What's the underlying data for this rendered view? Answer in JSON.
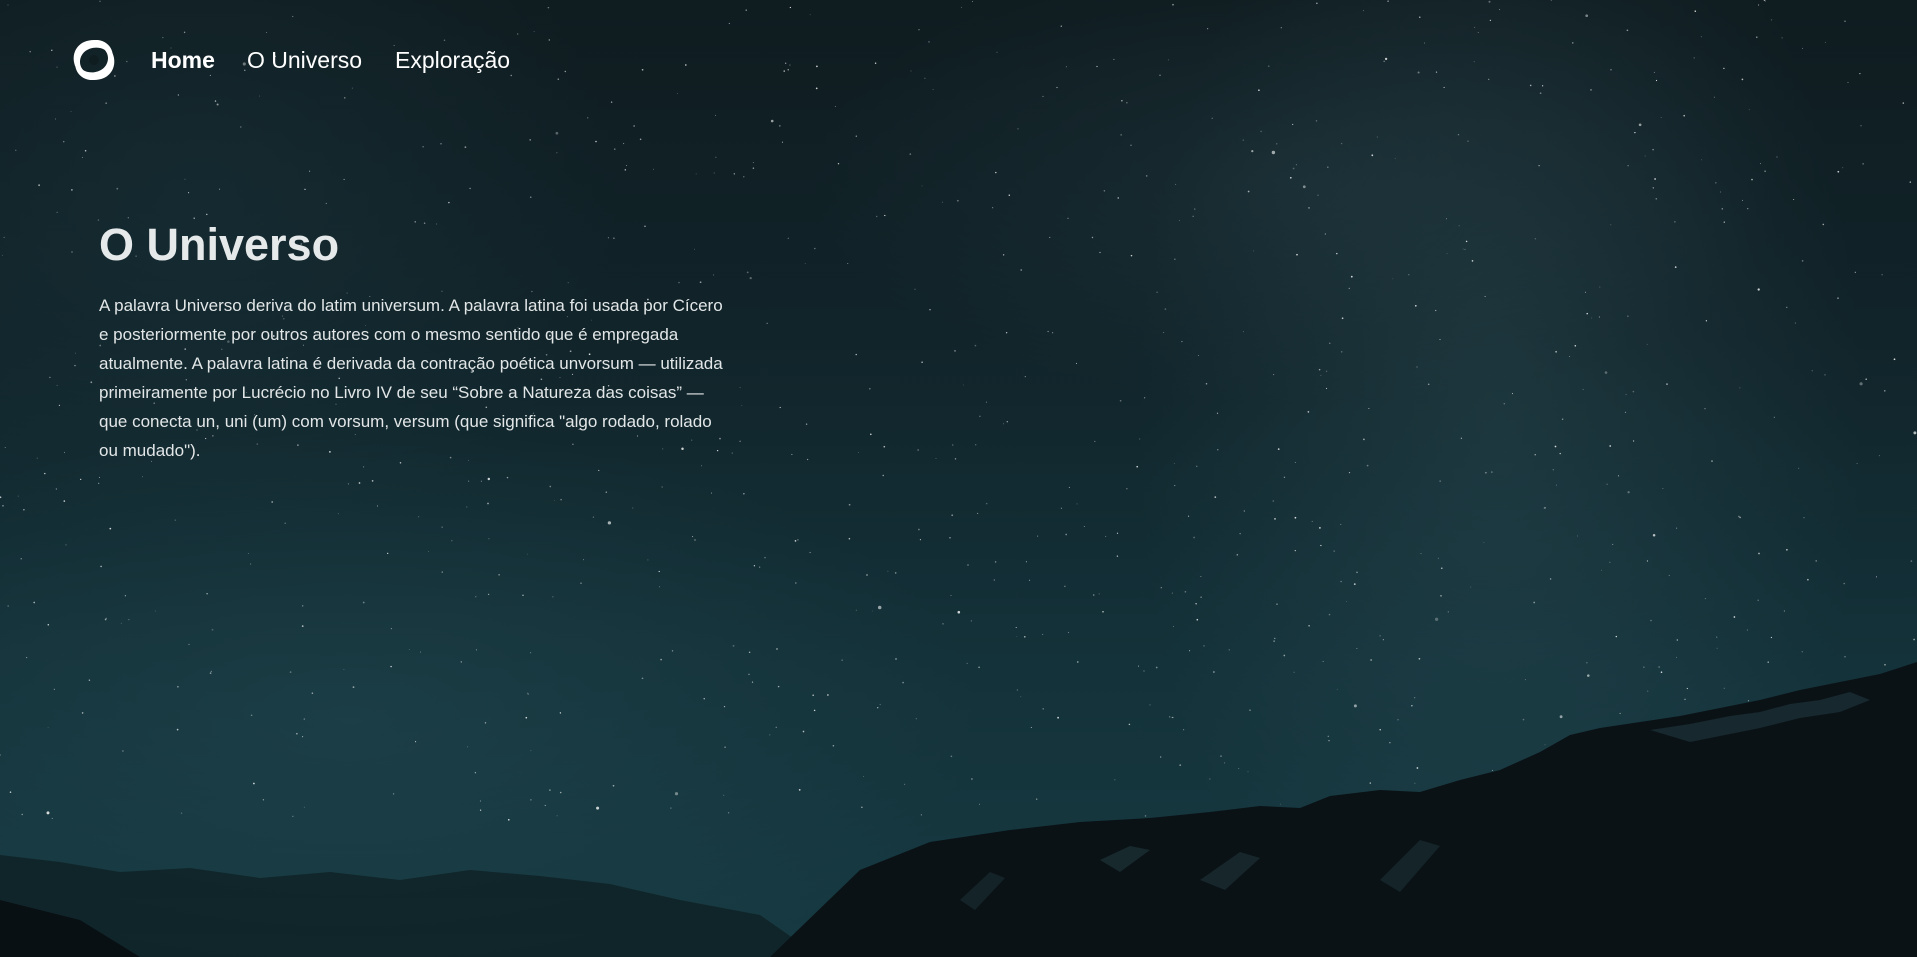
{
  "nav": {
    "logo_icon": "swirl-logo-icon",
    "items": [
      {
        "label": "Home",
        "active": true
      },
      {
        "label": "O Universo",
        "active": false
      },
      {
        "label": "Exploração",
        "active": false
      }
    ]
  },
  "hero": {
    "title": "O Universo",
    "paragraph": "A palavra Universo deriva do latim universum. A palavra latina foi usada por Cícero e posteriormente por outros autores com o mesmo sentido que é empregada atualmente. A palavra latina é derivada da contração poética unvorsum — utilizada primeiramente por Lucrécio no Livro IV de seu “Sobre a Natureza das coisas” — que conecta un, uni (um) com vorsum, versum (que significa \"algo rodado, rolado ou mudado\")."
  },
  "colors": {
    "sky_dark": "#0f1c20",
    "sky_teal": "#173a42",
    "mountain": "#0a1114",
    "text": "#ffffff"
  }
}
